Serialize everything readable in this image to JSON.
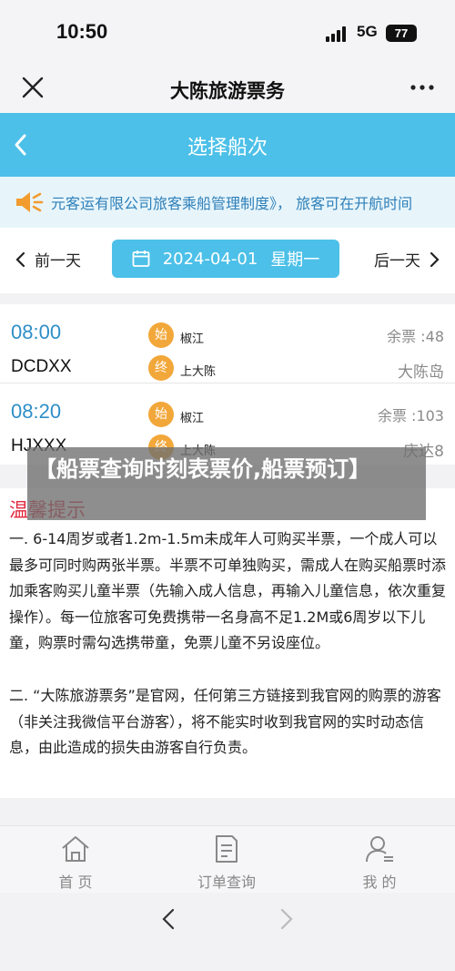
{
  "status": {
    "time": "10:50",
    "network": "5G",
    "battery": "77"
  },
  "window": {
    "title": "大陈旅游票务"
  },
  "header": {
    "title": "选择船次"
  },
  "notice": {
    "text": "元客运有限公司旅客乘船管理制度》， 旅客可在开航时间"
  },
  "datebar": {
    "prev_label": "前一天",
    "next_label": "后一天",
    "date": "2024-04-01",
    "weekday": "星期一"
  },
  "trips": [
    {
      "time": "08:00",
      "code": "DCDXX",
      "start_badge": "始",
      "start_port": "椒江",
      "end_badge": "终",
      "end_port": "上大陈",
      "seats": "余票 :48",
      "destination": "大陈岛"
    },
    {
      "time": "08:20",
      "code": "HJXXX",
      "start_badge": "始",
      "start_port": "椒江",
      "end_badge": "终",
      "end_port": "上大陈",
      "seats": "余票 :103",
      "destination": "庆达8"
    }
  ],
  "overlay": {
    "text": "【船票查询时刻表票价,船票预订】"
  },
  "tips": {
    "heading": "温馨提示",
    "p1": "一. 6-14周岁或者1.2m-1.5m未成年人可购买半票，一个成人可以最多可同时购两张半票。半票不可单独购买，需成人在购买船票时添加乘客购买儿童半票（先输入成人信息，再输入儿童信息，依次重复操作）。每一位旅客可免费携带一名身高不足1.2M或6周岁以下儿童，购票时需勾选携带童，免票儿童不另设座位。",
    "p2": "二. “大陈旅游票务”是官网，任何第三方链接到我官网的购票的游客（非关注我微信平台游客），将不能实时收到我官网的实时动态信息，由此造成的损失由游客自行负责。"
  },
  "tabs": {
    "home": "首 页",
    "orders": "订单查询",
    "mine": "我 的"
  },
  "colors": {
    "accent": "#4cc0e8",
    "badge": "#f2a73a",
    "tip_heading": "#e0263c",
    "time_text": "#2e8fc8"
  }
}
